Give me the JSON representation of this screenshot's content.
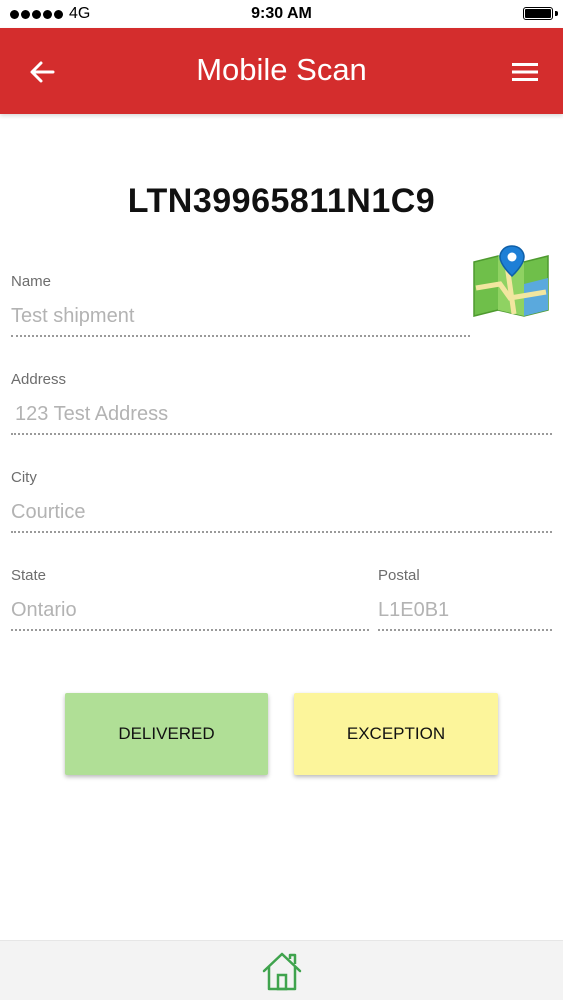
{
  "status_bar": {
    "carrier": "4G",
    "time": "9:30 AM"
  },
  "app_bar": {
    "title": "Mobile Scan",
    "back_icon": "arrow-left-icon",
    "menu_icon": "hamburger-menu-icon"
  },
  "shipment": {
    "tracking_number": "LTN39965811N1C9",
    "map_icon": "map-pin-icon"
  },
  "form": {
    "name": {
      "label": "Name",
      "value": "Test shipment"
    },
    "address": {
      "label": "Address",
      "value": "123 Test Address"
    },
    "city": {
      "label": "City",
      "value": "Courtice"
    },
    "state": {
      "label": "State",
      "value": "Ontario"
    },
    "postal": {
      "label": "Postal",
      "value": "L1E0B1"
    }
  },
  "actions": {
    "delivered_label": "DELIVERED",
    "exception_label": "EXCEPTION"
  },
  "bottom_bar": {
    "home_icon": "home-icon"
  },
  "colors": {
    "app_bar": "#d42d2d",
    "delivered": "#b0df96",
    "exception": "#fcf59b",
    "home_icon": "#3fa34d"
  }
}
